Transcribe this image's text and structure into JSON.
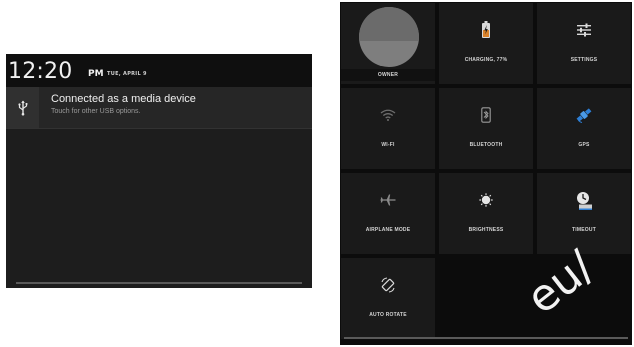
{
  "notification": {
    "time": "12:20",
    "ampm": "PM",
    "date": "TUE, APRIL 9",
    "item": {
      "icon": "usb-icon",
      "title": "Connected as a media device",
      "subtitle": "Touch for other USB options."
    }
  },
  "quick_settings": {
    "tiles": [
      {
        "id": "owner",
        "label": "OWNER",
        "icon": "user-avatar"
      },
      {
        "id": "battery",
        "label": "CHARGING, 77%",
        "icon": "battery-charging-icon"
      },
      {
        "id": "settings",
        "label": "SETTINGS",
        "icon": "settings-sliders-icon"
      },
      {
        "id": "wifi",
        "label": "WI-FI",
        "icon": "wifi-icon"
      },
      {
        "id": "bluetooth",
        "label": "BLUETOOTH",
        "icon": "bluetooth-icon"
      },
      {
        "id": "gps",
        "label": "GPS",
        "icon": "gps-satellite-icon"
      },
      {
        "id": "airplane",
        "label": "AIRPLANE MODE",
        "icon": "airplane-icon"
      },
      {
        "id": "brightness",
        "label": "BRIGHTNESS",
        "icon": "brightness-icon"
      },
      {
        "id": "timeout",
        "label": "TIMEOUT",
        "icon": "timeout-icon"
      },
      {
        "id": "rotate",
        "label": "AUTO ROTATE",
        "icon": "auto-rotate-icon"
      }
    ]
  },
  "watermark": {
    "text": "eu/"
  },
  "colors": {
    "accent_blue": "#2d7fd6",
    "battery_orange": "#d9822b"
  }
}
